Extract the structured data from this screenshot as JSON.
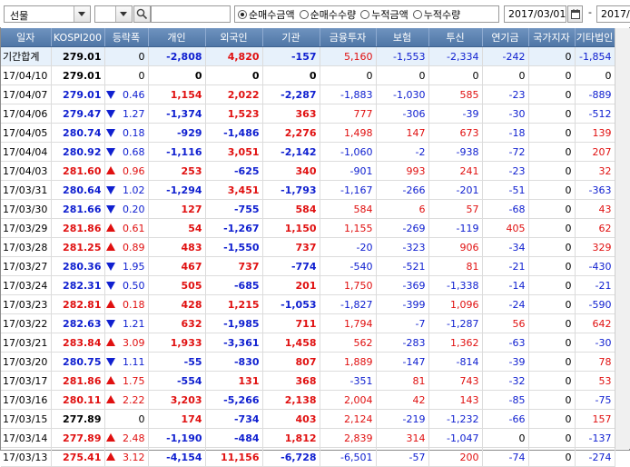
{
  "toolbar": {
    "market_select": "선물",
    "second_select": "",
    "search_value": "",
    "radios": [
      {
        "label": "순매수금액",
        "selected": true
      },
      {
        "label": "순매수수량",
        "selected": false
      },
      {
        "label": "누적금액",
        "selected": false
      },
      {
        "label": "누적수량",
        "selected": false
      }
    ],
    "start_date": "2017/03/01",
    "range_sep": "-",
    "end_date": "2017/0"
  },
  "table": {
    "columns": [
      "일자",
      "KOSPI200",
      "등락폭",
      "개인",
      "외국인",
      "기관",
      "금융투자",
      "보험",
      "투신",
      "연기금",
      "국가지자",
      "기타법인"
    ],
    "total": {
      "date": "기간합계",
      "kospi": "279.01",
      "chg": "0",
      "dir": "",
      "values": [
        "-2,808",
        "4,820",
        "-157",
        "5,160",
        "-1,553",
        "-2,334",
        "-242",
        "0",
        "-1,854"
      ]
    },
    "rows": [
      {
        "date": "17/04/10",
        "kospi": "279.01",
        "dir": "",
        "chg": "0",
        "values": [
          "0",
          "0",
          "0",
          "0",
          "0",
          "0",
          "0",
          "0",
          "0"
        ]
      },
      {
        "date": "17/04/07",
        "kospi": "279.01",
        "dir": "down",
        "chg": "0.46",
        "values": [
          "1,154",
          "2,022",
          "-2,287",
          "-1,883",
          "-1,030",
          "585",
          "-23",
          "0",
          "-889"
        ]
      },
      {
        "date": "17/04/06",
        "kospi": "279.47",
        "dir": "down",
        "chg": "1.27",
        "values": [
          "-1,374",
          "1,523",
          "363",
          "777",
          "-306",
          "-39",
          "-30",
          "0",
          "-512"
        ]
      },
      {
        "date": "17/04/05",
        "kospi": "280.74",
        "dir": "down",
        "chg": "0.18",
        "values": [
          "-929",
          "-1,486",
          "2,276",
          "1,498",
          "147",
          "673",
          "-18",
          "0",
          "139"
        ]
      },
      {
        "date": "17/04/04",
        "kospi": "280.92",
        "dir": "down",
        "chg": "0.68",
        "values": [
          "-1,116",
          "3,051",
          "-2,142",
          "-1,060",
          "-2",
          "-938",
          "-72",
          "0",
          "207"
        ]
      },
      {
        "date": "17/04/03",
        "kospi": "281.60",
        "dir": "up",
        "chg": "0.96",
        "values": [
          "253",
          "-625",
          "340",
          "-901",
          "993",
          "241",
          "-23",
          "0",
          "32"
        ]
      },
      {
        "date": "17/03/31",
        "kospi": "280.64",
        "dir": "down",
        "chg": "1.02",
        "values": [
          "-1,294",
          "3,451",
          "-1,793",
          "-1,167",
          "-266",
          "-201",
          "-51",
          "0",
          "-363"
        ]
      },
      {
        "date": "17/03/30",
        "kospi": "281.66",
        "dir": "down",
        "chg": "0.20",
        "values": [
          "127",
          "-755",
          "584",
          "584",
          "6",
          "57",
          "-68",
          "0",
          "43"
        ]
      },
      {
        "date": "17/03/29",
        "kospi": "281.86",
        "dir": "up",
        "chg": "0.61",
        "values": [
          "54",
          "-1,267",
          "1,150",
          "1,155",
          "-269",
          "-119",
          "405",
          "0",
          "62"
        ]
      },
      {
        "date": "17/03/28",
        "kospi": "281.25",
        "dir": "up",
        "chg": "0.89",
        "values": [
          "483",
          "-1,550",
          "737",
          "-20",
          "-323",
          "906",
          "-34",
          "0",
          "329"
        ]
      },
      {
        "date": "17/03/27",
        "kospi": "280.36",
        "dir": "down",
        "chg": "1.95",
        "values": [
          "467",
          "737",
          "-774",
          "-540",
          "-521",
          "81",
          "-21",
          "0",
          "-430"
        ]
      },
      {
        "date": "17/03/24",
        "kospi": "282.31",
        "dir": "down",
        "chg": "0.50",
        "values": [
          "505",
          "-685",
          "201",
          "1,750",
          "-369",
          "-1,338",
          "-14",
          "0",
          "-21"
        ]
      },
      {
        "date": "17/03/23",
        "kospi": "282.81",
        "dir": "up",
        "chg": "0.18",
        "values": [
          "428",
          "1,215",
          "-1,053",
          "-1,827",
          "-399",
          "1,096",
          "-24",
          "0",
          "-590"
        ]
      },
      {
        "date": "17/03/22",
        "kospi": "282.63",
        "dir": "down",
        "chg": "1.21",
        "values": [
          "632",
          "-1,985",
          "711",
          "1,794",
          "-7",
          "-1,287",
          "56",
          "0",
          "642"
        ]
      },
      {
        "date": "17/03/21",
        "kospi": "283.84",
        "dir": "up",
        "chg": "3.09",
        "values": [
          "1,933",
          "-3,361",
          "1,458",
          "562",
          "-283",
          "1,362",
          "-63",
          "0",
          "-30"
        ]
      },
      {
        "date": "17/03/20",
        "kospi": "280.75",
        "dir": "down",
        "chg": "1.11",
        "values": [
          "-55",
          "-830",
          "807",
          "1,889",
          "-147",
          "-814",
          "-39",
          "0",
          "78"
        ]
      },
      {
        "date": "17/03/17",
        "kospi": "281.86",
        "dir": "up",
        "chg": "1.75",
        "values": [
          "-554",
          "131",
          "368",
          "-351",
          "81",
          "743",
          "-32",
          "0",
          "53"
        ]
      },
      {
        "date": "17/03/16",
        "kospi": "280.11",
        "dir": "up",
        "chg": "2.22",
        "values": [
          "3,203",
          "-5,266",
          "2,138",
          "2,004",
          "42",
          "143",
          "-85",
          "0",
          "-75"
        ]
      },
      {
        "date": "17/03/15",
        "kospi": "277.89",
        "dir": "",
        "chg": "0",
        "values": [
          "174",
          "-734",
          "403",
          "2,124",
          "-219",
          "-1,232",
          "-66",
          "0",
          "157"
        ]
      },
      {
        "date": "17/03/14",
        "kospi": "277.89",
        "dir": "up",
        "chg": "2.48",
        "values": [
          "-1,190",
          "-484",
          "1,812",
          "2,839",
          "314",
          "-1,047",
          "0",
          "0",
          "-137"
        ]
      },
      {
        "date": "17/03/13",
        "kospi": "275.41",
        "dir": "up",
        "chg": "3.12",
        "values": [
          "-4,154",
          "11,156",
          "-6,728",
          "-6,501",
          "-57",
          "200",
          "-74",
          "0",
          "-274"
        ]
      }
    ]
  },
  "colors": {
    "up": "#e01010",
    "down": "#1020d0",
    "header": "#5a7fae",
    "total_bg": "#e7f1fb"
  }
}
